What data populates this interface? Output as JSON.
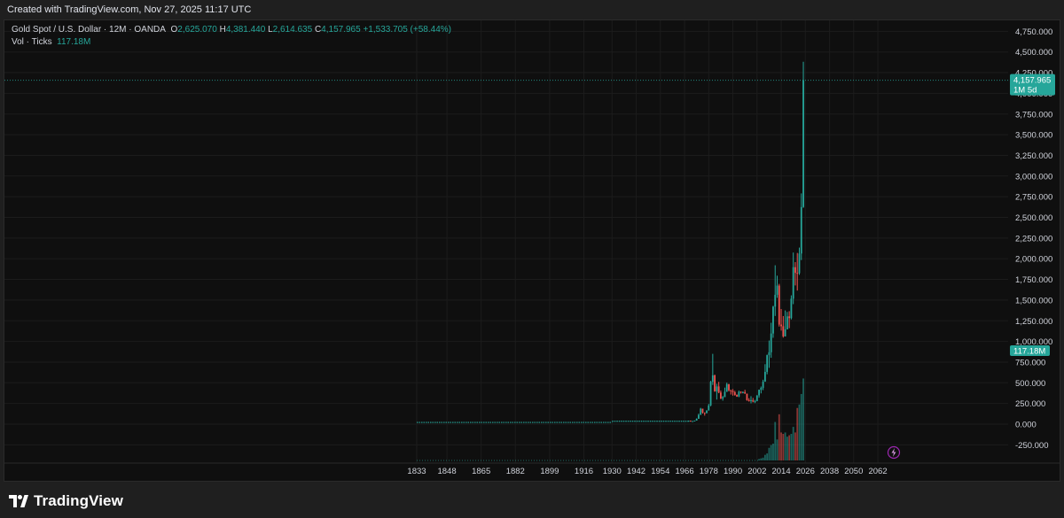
{
  "header": {
    "created_text": "Created with TradingView.com, Nov 27, 2025 11:17 UTC"
  },
  "legend": {
    "symbol": "Gold Spot / U.S. Dollar · 12M · OANDA",
    "open_label": "O",
    "open": "2,625.070",
    "high_label": "H",
    "high": "4,381.440",
    "low_label": "L",
    "low": "2,614.635",
    "close_label": "C",
    "close": "4,157.965",
    "change": "+1,533.705 (+58.44%)",
    "volume_label": "Vol · Ticks",
    "volume": "117.18M"
  },
  "price_tag": {
    "value": "4,157.965",
    "countdown": "1M 5d"
  },
  "volume_tag": "117.18M",
  "footer": {
    "brand": "TradingView"
  },
  "colors": {
    "up": "#26a69a",
    "down": "#ef5350",
    "background": "#0f0f0f",
    "grid": "#1c1c1c"
  },
  "chart_data": {
    "type": "candlestick",
    "x_axis": {
      "ticks": [
        "1833",
        "1848",
        "1865",
        "1882",
        "1899",
        "1916",
        "1930",
        "1942",
        "1954",
        "1966",
        "1978",
        "1990",
        "2002",
        "2014",
        "2026",
        "2038",
        "2050",
        "2062"
      ]
    },
    "y_axis": {
      "ticks": [
        "4,750.000",
        "4,500.000",
        "4,250.000",
        "4,000.000",
        "3,750.000",
        "3,500.000",
        "3,250.000",
        "3,000.000",
        "2,750.000",
        "2,500.000",
        "2,250.000",
        "2,000.000",
        "1,750.000",
        "1,500.000",
        "1,250.000",
        "1,000.000",
        "750.000",
        "500.000",
        "250.000",
        "0.000",
        "-250.000"
      ],
      "ylim": [
        -250,
        4750
      ]
    },
    "flat_series": {
      "start_year": 1833,
      "end_year": 1968,
      "value_before_1930": 20.67,
      "value_after_1930": 35
    },
    "candles": [
      {
        "year": 1968,
        "o": 35,
        "h": 43,
        "l": 35,
        "c": 41
      },
      {
        "year": 1969,
        "o": 41,
        "h": 43,
        "l": 35,
        "c": 35
      },
      {
        "year": 1970,
        "o": 35,
        "h": 39,
        "l": 35,
        "c": 37
      },
      {
        "year": 1971,
        "o": 37,
        "h": 44,
        "l": 37,
        "c": 43
      },
      {
        "year": 1972,
        "o": 43,
        "h": 70,
        "l": 43,
        "c": 65
      },
      {
        "year": 1973,
        "o": 65,
        "h": 127,
        "l": 64,
        "c": 112
      },
      {
        "year": 1974,
        "o": 112,
        "h": 197,
        "l": 112,
        "c": 187
      },
      {
        "year": 1975,
        "o": 187,
        "h": 186,
        "l": 128,
        "c": 140
      },
      {
        "year": 1976,
        "o": 140,
        "h": 140,
        "l": 103,
        "c": 135
      },
      {
        "year": 1977,
        "o": 135,
        "h": 168,
        "l": 129,
        "c": 165
      },
      {
        "year": 1978,
        "o": 165,
        "h": 245,
        "l": 165,
        "c": 226
      },
      {
        "year": 1979,
        "o": 226,
        "h": 524,
        "l": 216,
        "c": 512
      },
      {
        "year": 1980,
        "o": 512,
        "h": 850,
        "l": 474,
        "c": 590
      },
      {
        "year": 1981,
        "o": 590,
        "h": 599,
        "l": 391,
        "c": 397
      },
      {
        "year": 1982,
        "o": 397,
        "h": 488,
        "l": 297,
        "c": 456
      },
      {
        "year": 1983,
        "o": 456,
        "h": 511,
        "l": 374,
        "c": 382
      },
      {
        "year": 1984,
        "o": 382,
        "h": 406,
        "l": 303,
        "c": 309
      },
      {
        "year": 1985,
        "o": 309,
        "h": 341,
        "l": 284,
        "c": 327
      },
      {
        "year": 1986,
        "o": 327,
        "h": 442,
        "l": 326,
        "c": 391
      },
      {
        "year": 1987,
        "o": 391,
        "h": 502,
        "l": 390,
        "c": 484
      },
      {
        "year": 1988,
        "o": 484,
        "h": 485,
        "l": 395,
        "c": 410
      },
      {
        "year": 1989,
        "o": 410,
        "h": 417,
        "l": 358,
        "c": 401
      },
      {
        "year": 1990,
        "o": 401,
        "h": 424,
        "l": 345,
        "c": 386
      },
      {
        "year": 1991,
        "o": 386,
        "h": 403,
        "l": 344,
        "c": 353
      },
      {
        "year": 1992,
        "o": 353,
        "h": 360,
        "l": 330,
        "c": 333
      },
      {
        "year": 1993,
        "o": 333,
        "h": 406,
        "l": 326,
        "c": 391
      },
      {
        "year": 1994,
        "o": 391,
        "h": 397,
        "l": 370,
        "c": 383
      },
      {
        "year": 1995,
        "o": 383,
        "h": 396,
        "l": 372,
        "c": 387
      },
      {
        "year": 1996,
        "o": 387,
        "h": 415,
        "l": 367,
        "c": 369
      },
      {
        "year": 1997,
        "o": 369,
        "h": 367,
        "l": 283,
        "c": 290
      },
      {
        "year": 1998,
        "o": 290,
        "h": 313,
        "l": 273,
        "c": 288
      },
      {
        "year": 1999,
        "o": 288,
        "h": 338,
        "l": 252,
        "c": 290
      },
      {
        "year": 2000,
        "o": 290,
        "h": 317,
        "l": 263,
        "c": 273
      },
      {
        "year": 2001,
        "o": 273,
        "h": 293,
        "l": 255,
        "c": 279
      },
      {
        "year": 2002,
        "o": 279,
        "h": 350,
        "l": 277,
        "c": 348
      },
      {
        "year": 2003,
        "o": 348,
        "h": 417,
        "l": 320,
        "c": 416
      },
      {
        "year": 2004,
        "o": 416,
        "h": 455,
        "l": 372,
        "c": 438
      },
      {
        "year": 2005,
        "o": 438,
        "h": 537,
        "l": 411,
        "c": 513
      },
      {
        "year": 2006,
        "o": 513,
        "h": 725,
        "l": 515,
        "c": 632
      },
      {
        "year": 2007,
        "o": 632,
        "h": 841,
        "l": 603,
        "c": 834
      },
      {
        "year": 2008,
        "o": 834,
        "h": 1011,
        "l": 681,
        "c": 869
      },
      {
        "year": 2009,
        "o": 869,
        "h": 1226,
        "l": 802,
        "c": 1096
      },
      {
        "year": 2010,
        "o": 1096,
        "h": 1431,
        "l": 1044,
        "c": 1421
      },
      {
        "year": 2011,
        "o": 1421,
        "h": 1921,
        "l": 1308,
        "c": 1564
      },
      {
        "year": 2012,
        "o": 1564,
        "h": 1795,
        "l": 1527,
        "c": 1675
      },
      {
        "year": 2013,
        "o": 1675,
        "h": 1696,
        "l": 1180,
        "c": 1204
      },
      {
        "year": 2014,
        "o": 1204,
        "h": 1392,
        "l": 1131,
        "c": 1184
      },
      {
        "year": 2015,
        "o": 1184,
        "h": 1307,
        "l": 1046,
        "c": 1061
      },
      {
        "year": 2016,
        "o": 1061,
        "h": 1375,
        "l": 1061,
        "c": 1146
      },
      {
        "year": 2017,
        "o": 1146,
        "h": 1357,
        "l": 1146,
        "c": 1303
      },
      {
        "year": 2018,
        "o": 1303,
        "h": 1366,
        "l": 1160,
        "c": 1282
      },
      {
        "year": 2019,
        "o": 1282,
        "h": 1557,
        "l": 1266,
        "c": 1517
      },
      {
        "year": 2020,
        "o": 1517,
        "h": 2075,
        "l": 1451,
        "c": 1898
      },
      {
        "year": 2021,
        "o": 1898,
        "h": 1959,
        "l": 1677,
        "c": 1829
      },
      {
        "year": 2022,
        "o": 1829,
        "h": 2070,
        "l": 1615,
        "c": 1824
      },
      {
        "year": 2023,
        "o": 1824,
        "h": 2135,
        "l": 1805,
        "c": 2063
      },
      {
        "year": 2024,
        "o": 2063,
        "h": 2790,
        "l": 1984,
        "c": 2625
      },
      {
        "year": 2025,
        "o": 2625.07,
        "h": 4381.44,
        "l": 2614.635,
        "c": 4157.965
      }
    ],
    "volume": [
      {
        "year": 2003,
        "v": 2,
        "dir": "up"
      },
      {
        "year": 2004,
        "v": 3,
        "dir": "up"
      },
      {
        "year": 2005,
        "v": 4,
        "dir": "up"
      },
      {
        "year": 2006,
        "v": 8,
        "dir": "up"
      },
      {
        "year": 2007,
        "v": 10,
        "dir": "up"
      },
      {
        "year": 2008,
        "v": 18,
        "dir": "up"
      },
      {
        "year": 2009,
        "v": 22,
        "dir": "up"
      },
      {
        "year": 2010,
        "v": 24,
        "dir": "up"
      },
      {
        "year": 2011,
        "v": 55,
        "dir": "up"
      },
      {
        "year": 2012,
        "v": 30,
        "dir": "up"
      },
      {
        "year": 2013,
        "v": 66,
        "dir": "down"
      },
      {
        "year": 2014,
        "v": 40,
        "dir": "down"
      },
      {
        "year": 2015,
        "v": 38,
        "dir": "down"
      },
      {
        "year": 2016,
        "v": 40,
        "dir": "up"
      },
      {
        "year": 2017,
        "v": 34,
        "dir": "up"
      },
      {
        "year": 2018,
        "v": 36,
        "dir": "down"
      },
      {
        "year": 2019,
        "v": 38,
        "dir": "up"
      },
      {
        "year": 2020,
        "v": 48,
        "dir": "up"
      },
      {
        "year": 2021,
        "v": 40,
        "dir": "down"
      },
      {
        "year": 2022,
        "v": 75,
        "dir": "down"
      },
      {
        "year": 2023,
        "v": 80,
        "dir": "up"
      },
      {
        "year": 2024,
        "v": 95,
        "dir": "up"
      },
      {
        "year": 2025,
        "v": 117.18,
        "dir": "up"
      }
    ]
  }
}
